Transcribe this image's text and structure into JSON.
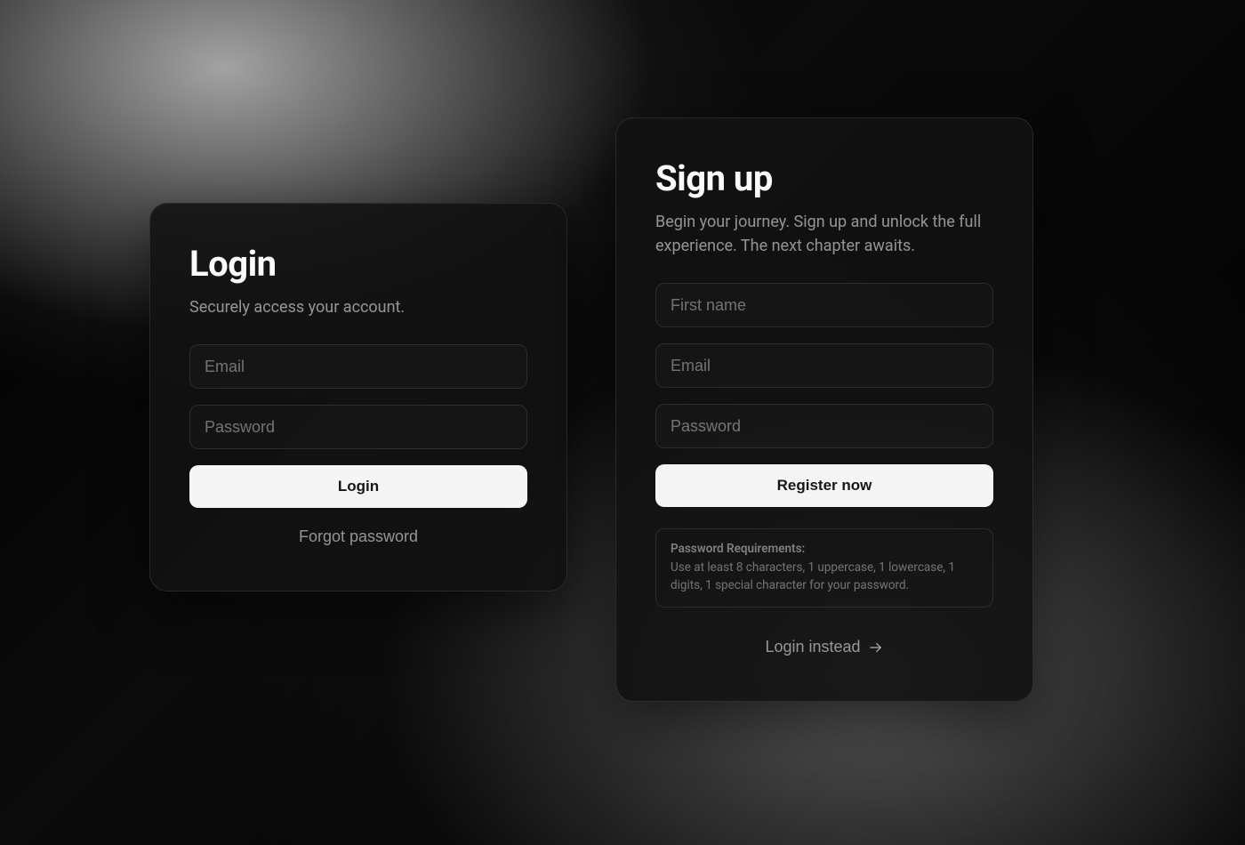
{
  "login": {
    "title": "Login",
    "subtitle": "Securely access your account.",
    "email_placeholder": "Email",
    "password_placeholder": "Password",
    "submit_label": "Login",
    "forgot_label": "Forgot password"
  },
  "signup": {
    "title": "Sign up",
    "subtitle": "Begin your journey. Sign up and unlock the full experience. The next chapter awaits.",
    "firstname_placeholder": "First name",
    "email_placeholder": "Email",
    "password_placeholder": "Password",
    "submit_label": "Register now",
    "req_title": "Password Requirements:",
    "req_body": "Use at least 8 characters, 1 uppercase, 1 lowercase, 1 digits, 1 special character for your password.",
    "alt_link_label": "Login instead"
  }
}
